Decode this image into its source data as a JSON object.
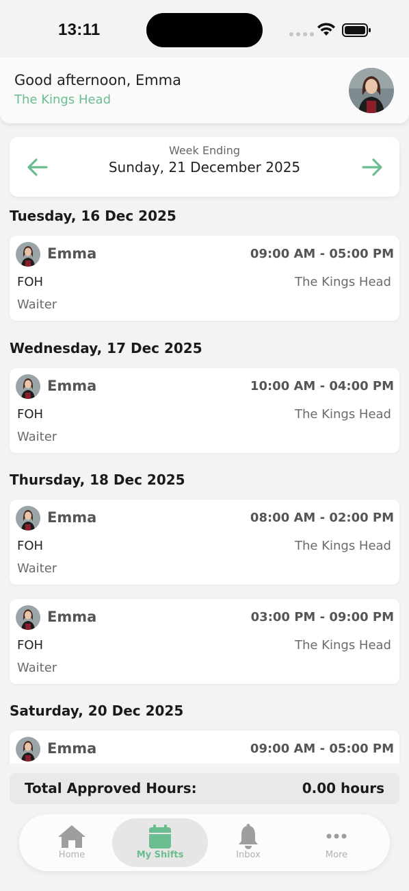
{
  "status_bar": {
    "time": "13:11"
  },
  "header": {
    "greeting": "Good afternoon, Emma",
    "venue": "The Kings Head"
  },
  "week": {
    "caption": "Week Ending",
    "date": "Sunday, 21 December 2025"
  },
  "days": [
    {
      "heading": "Tuesday, 16 Dec 2025",
      "shifts": [
        {
          "name": "Emma",
          "time": "09:00 AM - 05:00 PM",
          "department": "FOH",
          "venue": "The Kings Head",
          "role": "Waiter"
        }
      ]
    },
    {
      "heading": "Wednesday, 17 Dec 2025",
      "shifts": [
        {
          "name": "Emma",
          "time": "10:00 AM - 04:00 PM",
          "department": "FOH",
          "venue": "The Kings Head",
          "role": "Waiter"
        }
      ]
    },
    {
      "heading": "Thursday, 18 Dec 2025",
      "shifts": [
        {
          "name": "Emma",
          "time": "08:00 AM - 02:00 PM",
          "department": "FOH",
          "venue": "The Kings Head",
          "role": "Waiter"
        },
        {
          "name": "Emma",
          "time": "03:00 PM - 09:00 PM",
          "department": "FOH",
          "venue": "The Kings Head",
          "role": "Waiter"
        }
      ]
    },
    {
      "heading": "Saturday, 20 Dec 2025",
      "shifts": [
        {
          "name": "Emma",
          "time": "09:00 AM - 05:00 PM",
          "department": "",
          "venue": "",
          "role": ""
        }
      ]
    }
  ],
  "totals": {
    "label": "Total Approved Hours:",
    "value": "0.00 hours"
  },
  "tabs": [
    {
      "label": "Home",
      "icon": "home-icon",
      "active": false
    },
    {
      "label": "My Shifts",
      "icon": "calendar-icon",
      "active": true
    },
    {
      "label": "Inbox",
      "icon": "bell-icon",
      "active": false
    },
    {
      "label": "More",
      "icon": "more-icon",
      "active": false
    }
  ],
  "colors": {
    "accent": "#6bbd8f",
    "background": "#f3f3f3",
    "card": "#ffffff"
  }
}
